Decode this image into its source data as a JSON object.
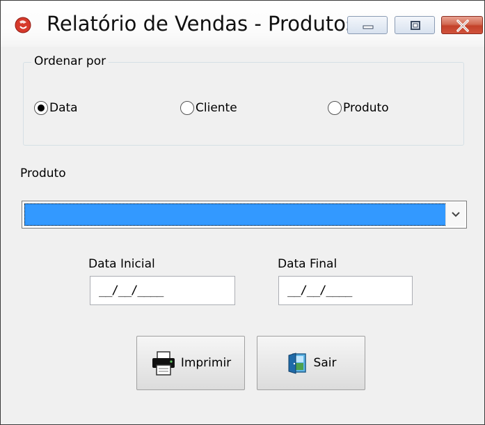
{
  "window": {
    "title": "Relatório de Vendas - Produtos"
  },
  "group": {
    "legend": "Ordenar por",
    "options": [
      {
        "label": "Data",
        "selected": true
      },
      {
        "label": "Cliente",
        "selected": false
      },
      {
        "label": "Produto",
        "selected": false
      }
    ]
  },
  "produto": {
    "label": "Produto",
    "selected_value": ""
  },
  "dates": {
    "initial_label": "Data Inicial",
    "initial_value": "__/__/____",
    "final_label": "Data Final",
    "final_value": "__/__/____"
  },
  "buttons": {
    "print_label": "Imprimir",
    "exit_label": "Sair"
  },
  "icons": {
    "app": "app-logo-icon",
    "minimize": "minimize-icon",
    "maximize": "maximize-icon",
    "close": "close-icon",
    "dropdown": "chevron-down-icon",
    "print": "printer-icon",
    "exit": "exit-door-icon"
  },
  "colors": {
    "selection": "#3399ff",
    "close_button": "#c3412a"
  }
}
